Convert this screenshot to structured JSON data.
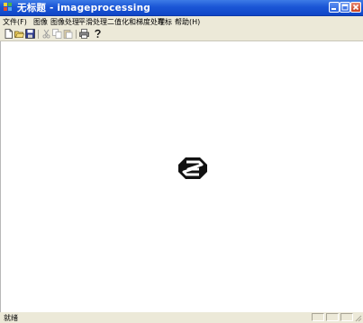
{
  "window": {
    "title": "无标题 - imageprocessing"
  },
  "menubar": {
    "items": [
      {
        "label": "文件(F)"
      },
      {
        "label": "图像"
      },
      {
        "label": "图像处理"
      },
      {
        "label": "平滑处理"
      },
      {
        "label": "二值化和梯度处理"
      },
      {
        "label": "车标"
      },
      {
        "label": "帮助(H)"
      }
    ]
  },
  "toolbar": {
    "tools": [
      "new-file-icon",
      "open-folder-icon",
      "save-disk-icon",
      "cut-icon",
      "copy-icon",
      "paste-icon",
      "print-icon",
      "help-icon"
    ]
  },
  "statusbar": {
    "text": "就绪"
  },
  "colors": {
    "titlebar": "#1b56d6",
    "chrome": "#ece9d8",
    "logo": "#111111"
  }
}
